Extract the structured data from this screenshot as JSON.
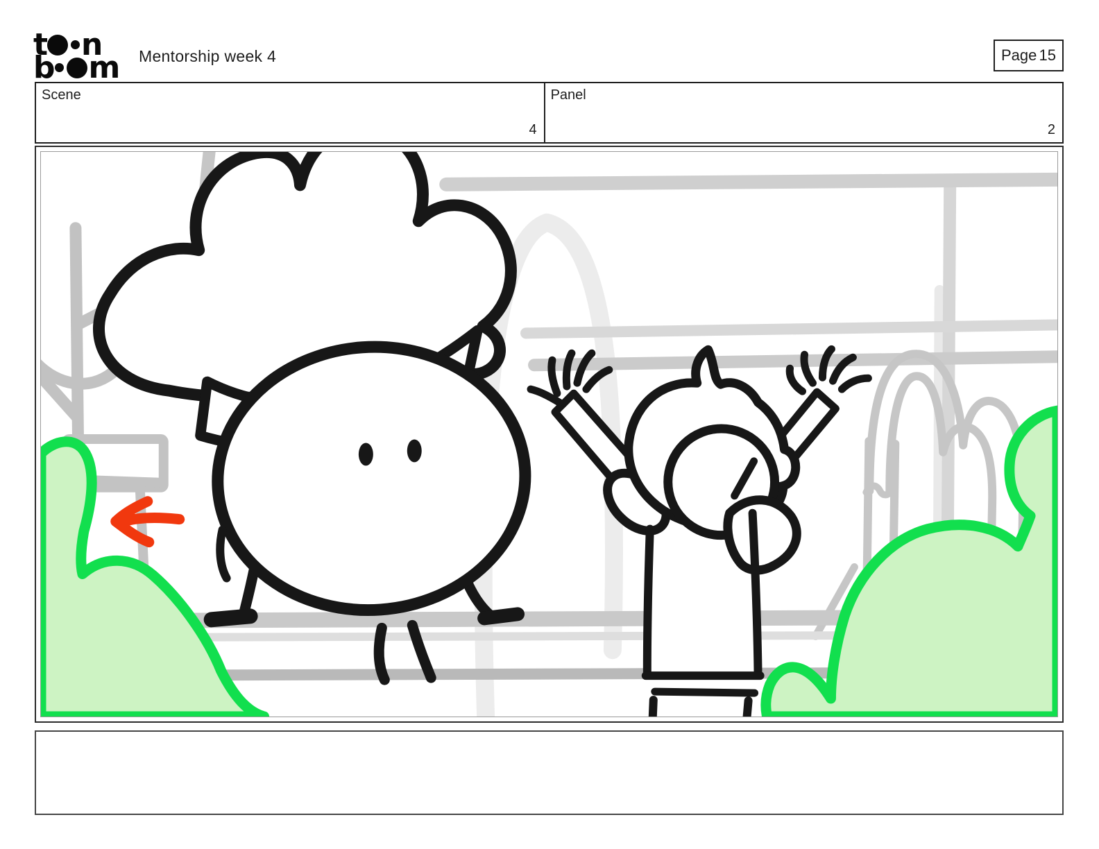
{
  "header": {
    "logo": {
      "brand": "Toon Boom",
      "row1_left": "t",
      "row1_right": "n",
      "row2_left": "b",
      "row2_right": "m"
    },
    "title": "Mentorship week 4",
    "page_box": {
      "label": "Page",
      "number": "15"
    }
  },
  "scene_panel_bar": {
    "scene": {
      "label": "Scene",
      "number": "4"
    },
    "panel": {
      "label": "Panel",
      "number": "2"
    }
  },
  "storyboard_panel": {
    "description": "Hand-drawn storyboard sketch: a round chef character with a puffy chef hat sits on a park bench next to a cheering person with arms raised; gray playground and trees in background, green bushes in both lower corners, red arrow annotation pointing left",
    "colors": {
      "ink": "#171717",
      "background_gray": "#c6c6c6",
      "light_gray": "#ececec",
      "bush_fill": "#cdf3c3",
      "bush_outline": "#12df4e",
      "annotation_red": "#f1380e"
    }
  },
  "caption_box": {
    "text": ""
  }
}
